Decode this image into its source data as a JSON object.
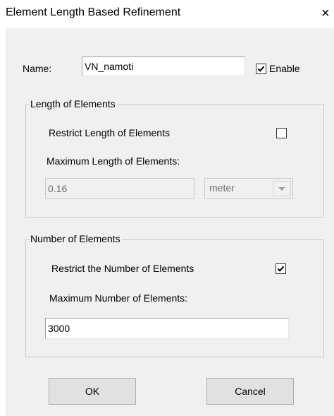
{
  "window": {
    "title": "Element Length Based Refinement",
    "close_label": "×"
  },
  "name_row": {
    "name_label": "Name:",
    "name_value": "VN_namoti",
    "enable_label": "Enable",
    "enable_checked": true
  },
  "length_group": {
    "legend": "Length of Elements",
    "restrict_label": "Restrict Length of Elements",
    "restrict_checked": false,
    "max_label": "Maximum Length of Elements:",
    "max_value": "0.16",
    "unit_value": "meter"
  },
  "number_group": {
    "legend": "Number of Elements",
    "restrict_label": "Restrict the Number of Elements",
    "restrict_checked": true,
    "max_label": "Maximum Number of  Elements:",
    "max_value": "3000"
  },
  "buttons": {
    "ok": "OK",
    "cancel": "Cancel"
  },
  "colors": {
    "dialog_bg": "#f0f0f0",
    "titlebar_bg": "#ffffff",
    "disabled_text": "#6d6d6d"
  }
}
